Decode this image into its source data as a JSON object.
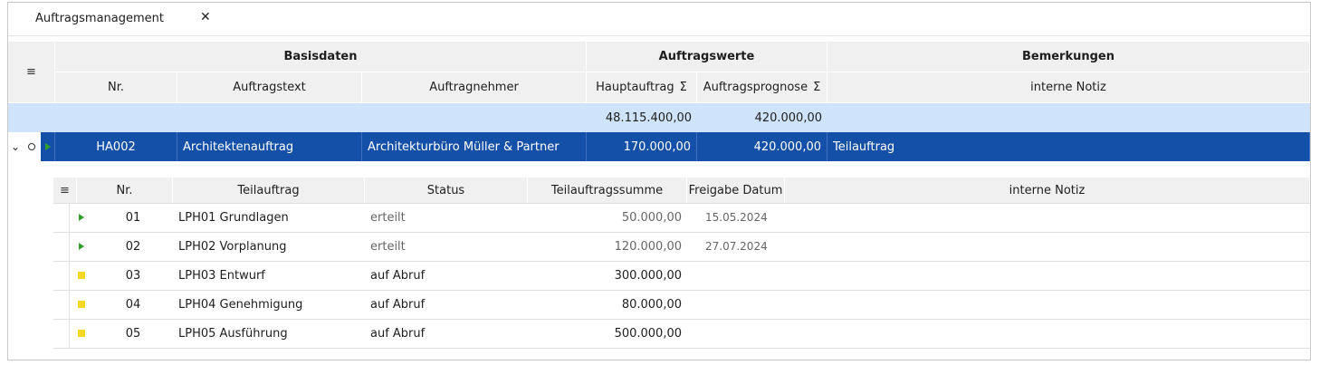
{
  "tab": {
    "title": "Auftragsmanagement",
    "close": "✕"
  },
  "groups": {
    "basisdaten": "Basisdaten",
    "auftragswerte": "Auftragswerte",
    "bemerkungen": "Bemerkungen"
  },
  "columns": {
    "nr": "Nr.",
    "auftragstext": "Auftragstext",
    "auftragnehmer": "Auftragnehmer",
    "hauptauftrag": "Hauptauftrag",
    "auftragsprognose": "Auftragsprognose",
    "sigma": "Σ",
    "interne_notiz": "interne Notiz"
  },
  "summary": {
    "hauptauftrag": "48.115.400,00",
    "auftragsprognose": "420.000,00"
  },
  "selected_row": {
    "nr": "HA002",
    "auftragstext": "Architektenauftrag",
    "auftragnehmer": "Architekturbüro Müller & Partner",
    "hauptauftrag": "170.000,00",
    "auftragsprognose": "420.000,00",
    "notiz": "Teilauftrag"
  },
  "detail": {
    "columns": {
      "nr": "Nr.",
      "teilauftrag": "Teilauftrag",
      "status": "Status",
      "summe": "Teilauftragssumme",
      "freigabe": "Freigabe Datum",
      "notiz": "interne Notiz"
    },
    "rows": [
      {
        "marker": "triangle",
        "nr": "01",
        "teilauftrag": "LPH01 Grundlagen",
        "status": "erteilt",
        "summe": "50.000,00",
        "freigabe": "15.05.2024"
      },
      {
        "marker": "triangle",
        "nr": "02",
        "teilauftrag": "LPH02 Vorplanung",
        "status": "erteilt",
        "summe": "120.000,00",
        "freigabe": "27.07.2024"
      },
      {
        "marker": "square",
        "nr": "03",
        "teilauftrag": "LPH03 Entwurf",
        "status": "auf Abruf",
        "summe": "300.000,00",
        "freigabe": ""
      },
      {
        "marker": "square",
        "nr": "04",
        "teilauftrag": "LPH04 Genehmigung",
        "status": "auf Abruf",
        "summe": "80.000,00",
        "freigabe": ""
      },
      {
        "marker": "square",
        "nr": "05",
        "teilauftrag": "LPH05 Ausführung",
        "status": "auf Abruf",
        "summe": "500.000,00",
        "freigabe": ""
      }
    ]
  },
  "icons": {
    "column-menu": "≡",
    "expand": "⌄"
  },
  "colors": {
    "selected": "#1450a8",
    "summary": "#cfe4fa",
    "active_marker": "#2e9e2e",
    "pending_marker": "#f5d823"
  }
}
